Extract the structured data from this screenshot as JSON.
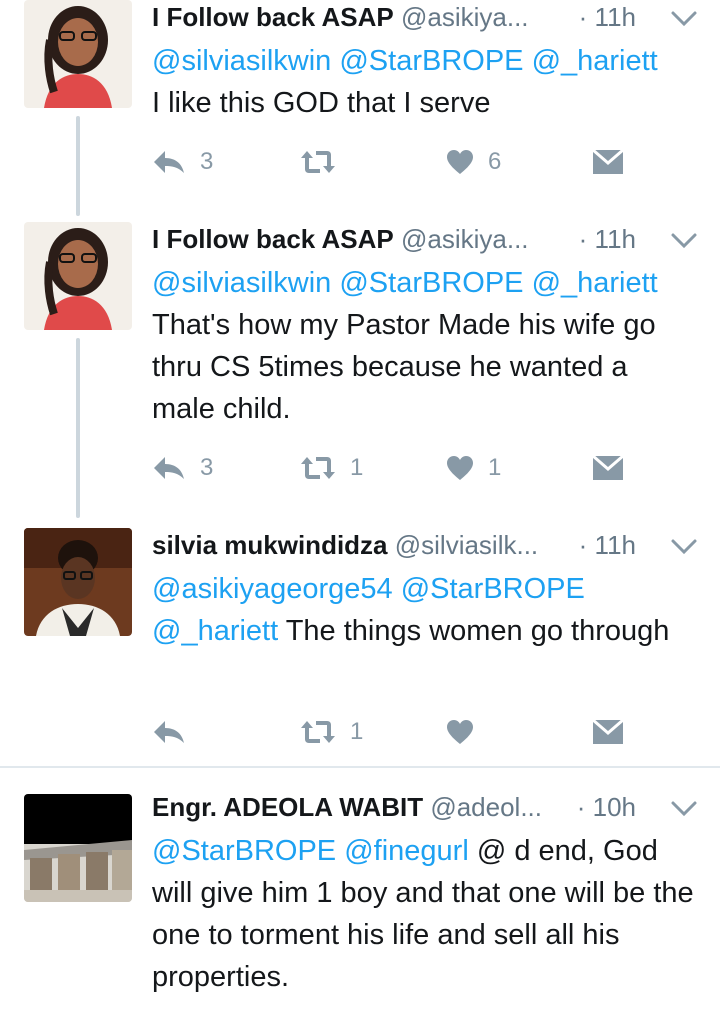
{
  "tweets": [
    {
      "name": "I Follow back ASAP",
      "handle": "@asikiya...",
      "dot": "·",
      "time": "11h",
      "mentions": "@silviasilkwin @StarBROPE @_hariett",
      "text": "I like this GOD that I serve",
      "reply_count": "3",
      "retweet_count": "",
      "like_count": "6"
    },
    {
      "name": "I Follow back ASAP",
      "handle": "@asikiya...",
      "dot": "·",
      "time": "11h",
      "mentions": "@silviasilkwin @StarBROPE @_hariett",
      "text": "That's how my Pastor Made his wife go thru CS 5times because he wanted a male child.",
      "reply_count": "3",
      "retweet_count": "1",
      "like_count": "1"
    },
    {
      "name": "silvia mukwindidza",
      "handle": "@silviasilk...",
      "dot": "·",
      "time": "11h",
      "mentions": "@asikiyageorge54 @StarBROPE @_hariett",
      "text": "The things women go through",
      "reply_count": "",
      "retweet_count": "1",
      "like_count": ""
    },
    {
      "name": "Engr. ADEOLA WABIT",
      "handle": "@adeol...",
      "dot": "·",
      "time": "10h",
      "mentions": "@StarBROPE @finegurl",
      "text": "@ d end, God will give him 1 boy and that one will be the one to torment his life and sell all his properties."
    }
  ],
  "icons": {
    "reply": "reply-icon",
    "retweet": "retweet-icon",
    "like": "heart-icon",
    "dm": "envelope-icon",
    "more": "chevron-down-icon"
  },
  "colors": {
    "link": "#1da1f2",
    "secondary": "#657786",
    "icon": "#8899a6",
    "thread_line": "#ccd6dd"
  }
}
